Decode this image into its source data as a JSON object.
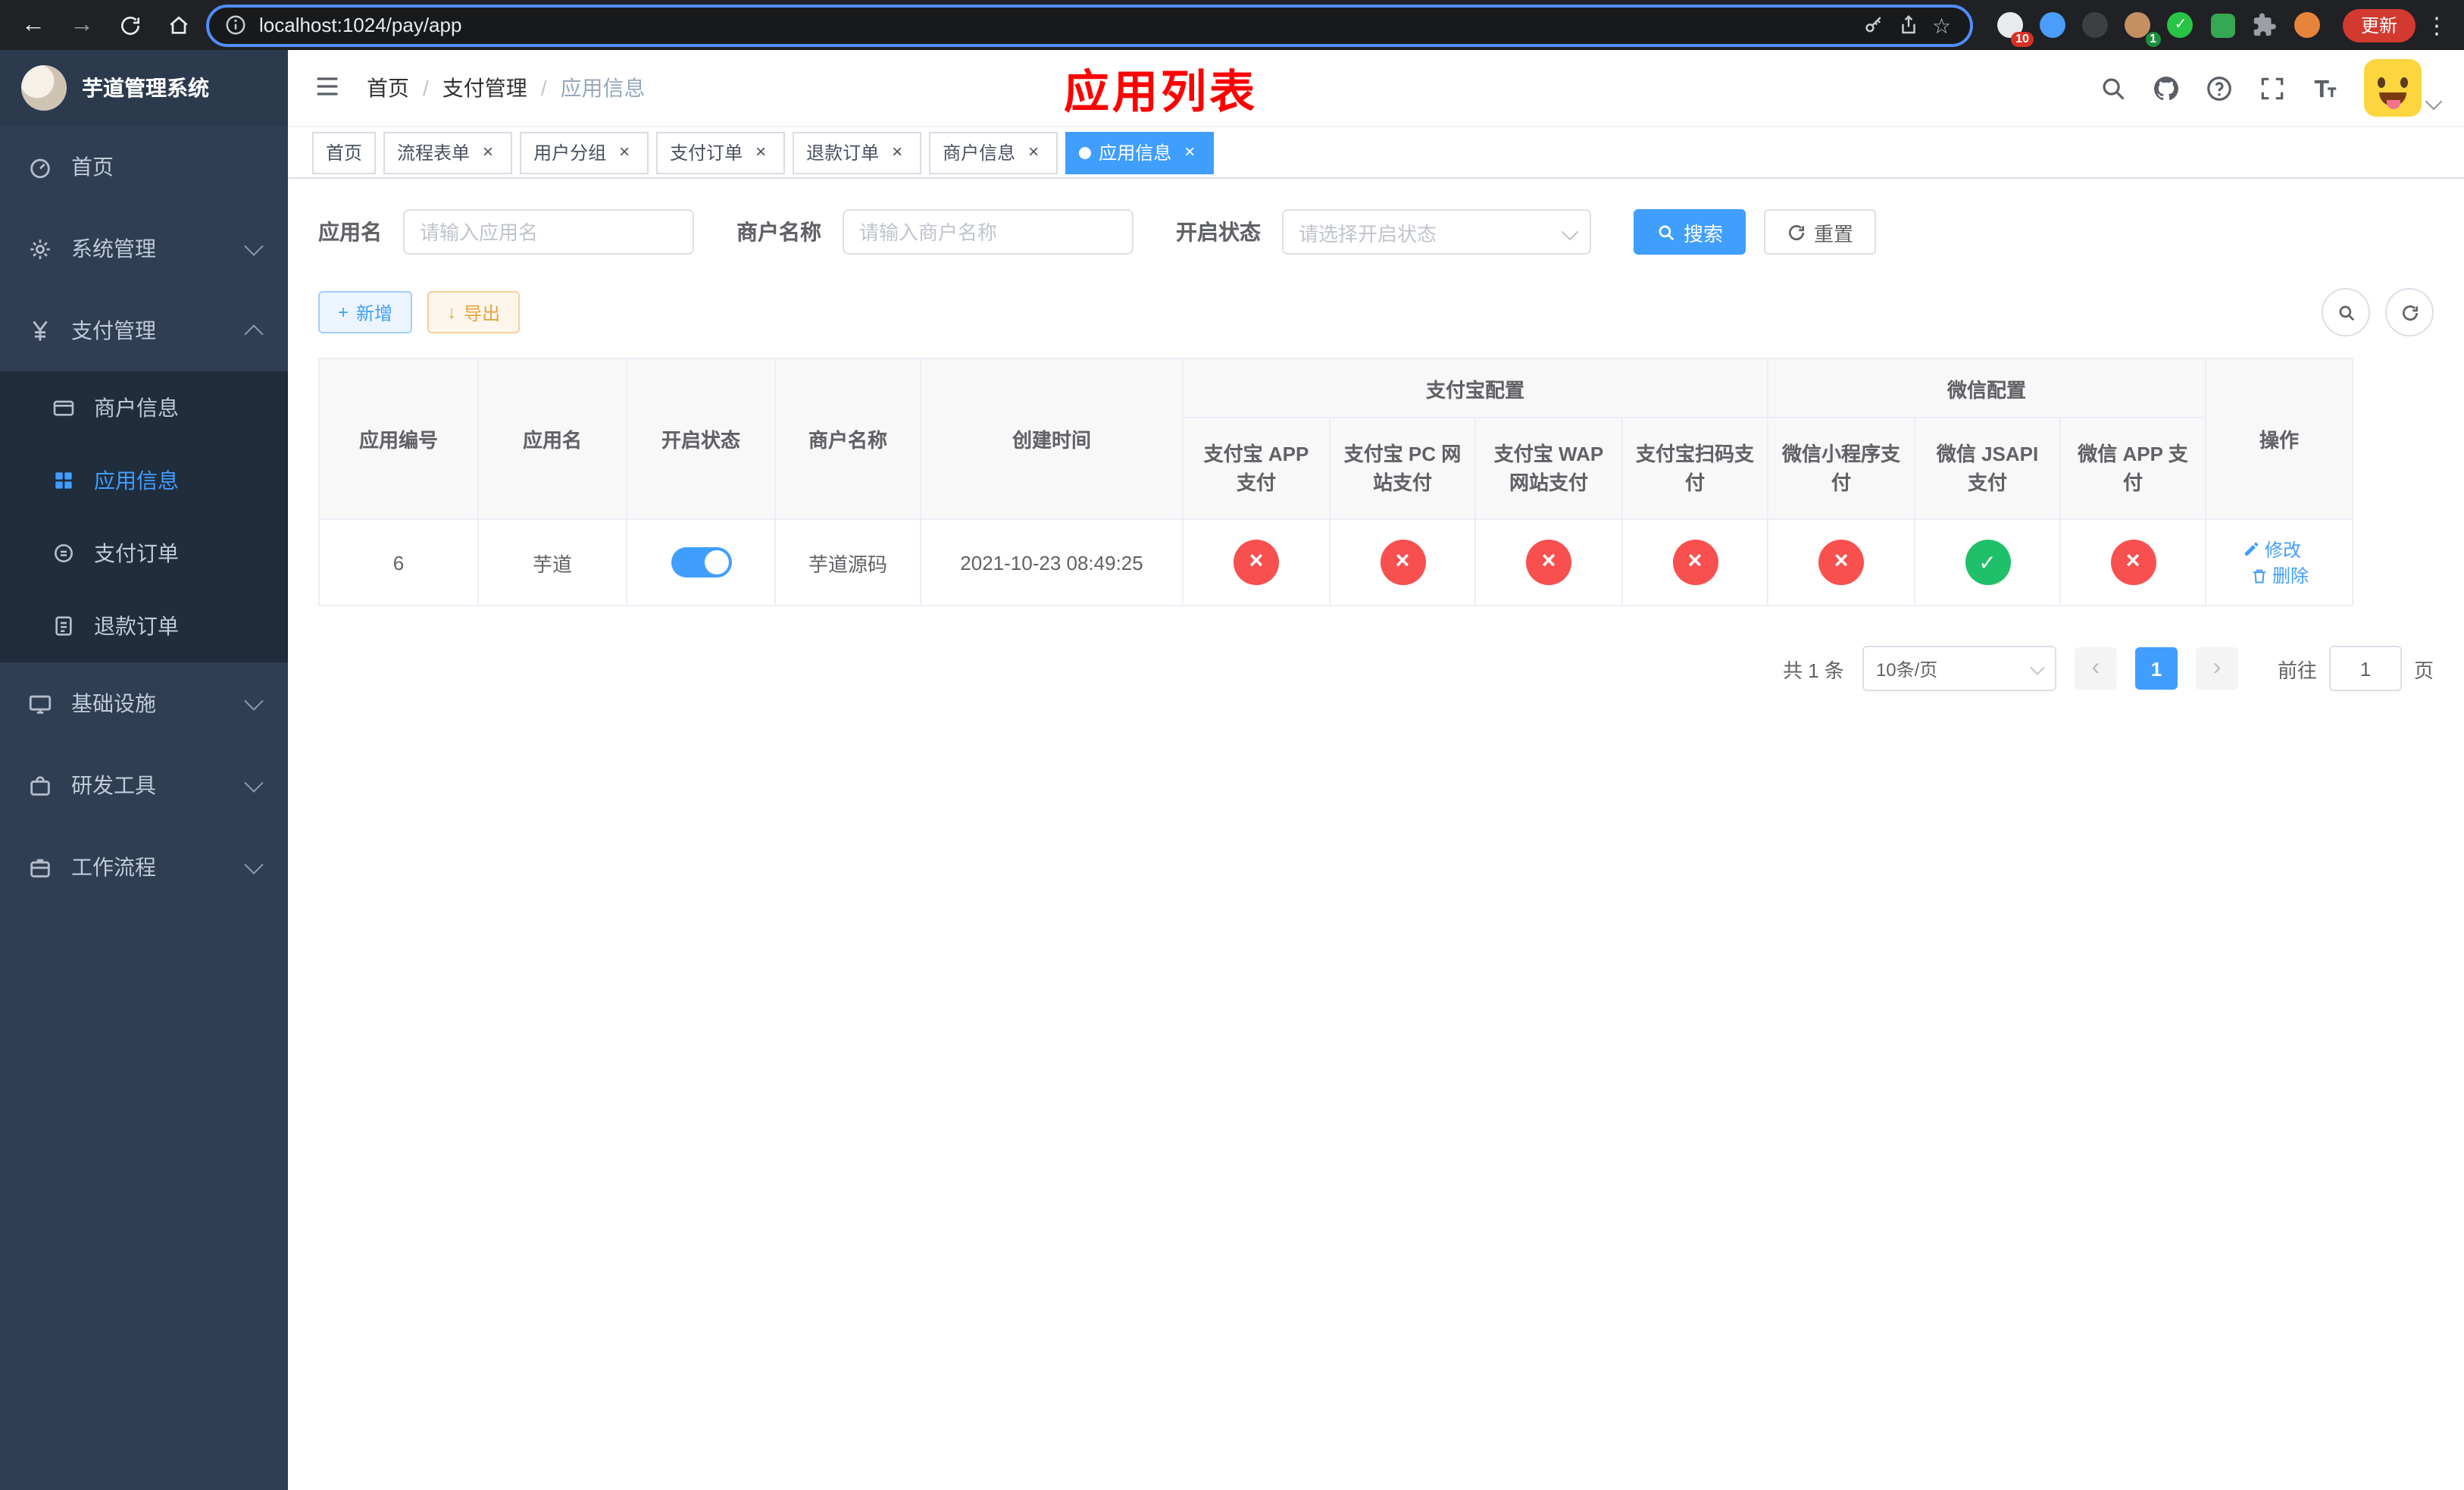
{
  "browser": {
    "url": "localhost:1024/pay/app",
    "update_label": "更新",
    "extension_badge_1": "10",
    "extension_badge_2": "1"
  },
  "sidebar": {
    "logo_title": "芋道管理系统",
    "menu": [
      {
        "label": "首页"
      },
      {
        "label": "系统管理"
      },
      {
        "label": "支付管理"
      },
      {
        "label": "基础设施"
      },
      {
        "label": "研发工具"
      },
      {
        "label": "工作流程"
      }
    ],
    "payment_children": [
      {
        "label": "商户信息"
      },
      {
        "label": "应用信息"
      },
      {
        "label": "支付订单"
      },
      {
        "label": "退款订单"
      }
    ]
  },
  "header": {
    "breadcrumb": [
      "首页",
      "支付管理",
      "应用信息"
    ],
    "annotation": "应用列表"
  },
  "tabs": [
    {
      "label": "首页"
    },
    {
      "label": "流程表单"
    },
    {
      "label": "用户分组"
    },
    {
      "label": "支付订单"
    },
    {
      "label": "退款订单"
    },
    {
      "label": "商户信息"
    },
    {
      "label": "应用信息"
    }
  ],
  "filters": {
    "app_name_label": "应用名",
    "app_name_placeholder": "请输入应用名",
    "merchant_name_label": "商户名称",
    "merchant_name_placeholder": "请输入商户名称",
    "status_label": "开启状态",
    "status_placeholder": "请选择开启状态",
    "search_label": "搜索",
    "reset_label": "重置"
  },
  "toolbar": {
    "add_label": "新增",
    "export_label": "导出"
  },
  "table": {
    "headers": {
      "app_id": "应用编号",
      "app_name": "应用名",
      "status": "开启状态",
      "merchant_name": "商户名称",
      "create_time": "创建时间",
      "alipay_group": "支付宝配置",
      "wechat_group": "微信配置",
      "actions": "操作",
      "alipay_app": "支付宝 APP 支付",
      "alipay_pc": "支付宝 PC 网站支付",
      "alipay_wap": "支付宝 WAP 网站支付",
      "alipay_qr": "支付宝扫码支付",
      "wx_lite": "微信小程序支付",
      "wx_jsapi": "微信 JSAPI 支付",
      "wx_app": "微信 APP 支付"
    },
    "row": {
      "app_id": "6",
      "app_name": "芋道",
      "merchant_name": "芋道源码",
      "create_time": "2021-10-23 08:49:25",
      "configs": [
        "fail",
        "fail",
        "fail",
        "fail",
        "fail",
        "success",
        "fail"
      ],
      "edit_label": "修改",
      "delete_label": "删除"
    }
  },
  "pagination": {
    "total_text": "共 1 条",
    "page_size_text": "10条/页",
    "current_page": "1",
    "goto_label": "前往",
    "goto_value": "1",
    "page_unit": "页"
  },
  "colors": {
    "primary": "#409eff",
    "danger": "#f8504f",
    "success": "#1fc06a",
    "warning": "#e6a23c",
    "sidebar_bg": "#2f3e52",
    "submenu_bg": "#1f2d3d"
  },
  "icons": {
    "close": "×",
    "back_arrow": "←",
    "forward_arrow": "→",
    "star": "☆",
    "more_vertical": "⋮",
    "plus": "+",
    "download_arrow": "↓",
    "check": "✓",
    "prev": "‹",
    "next": "›"
  }
}
